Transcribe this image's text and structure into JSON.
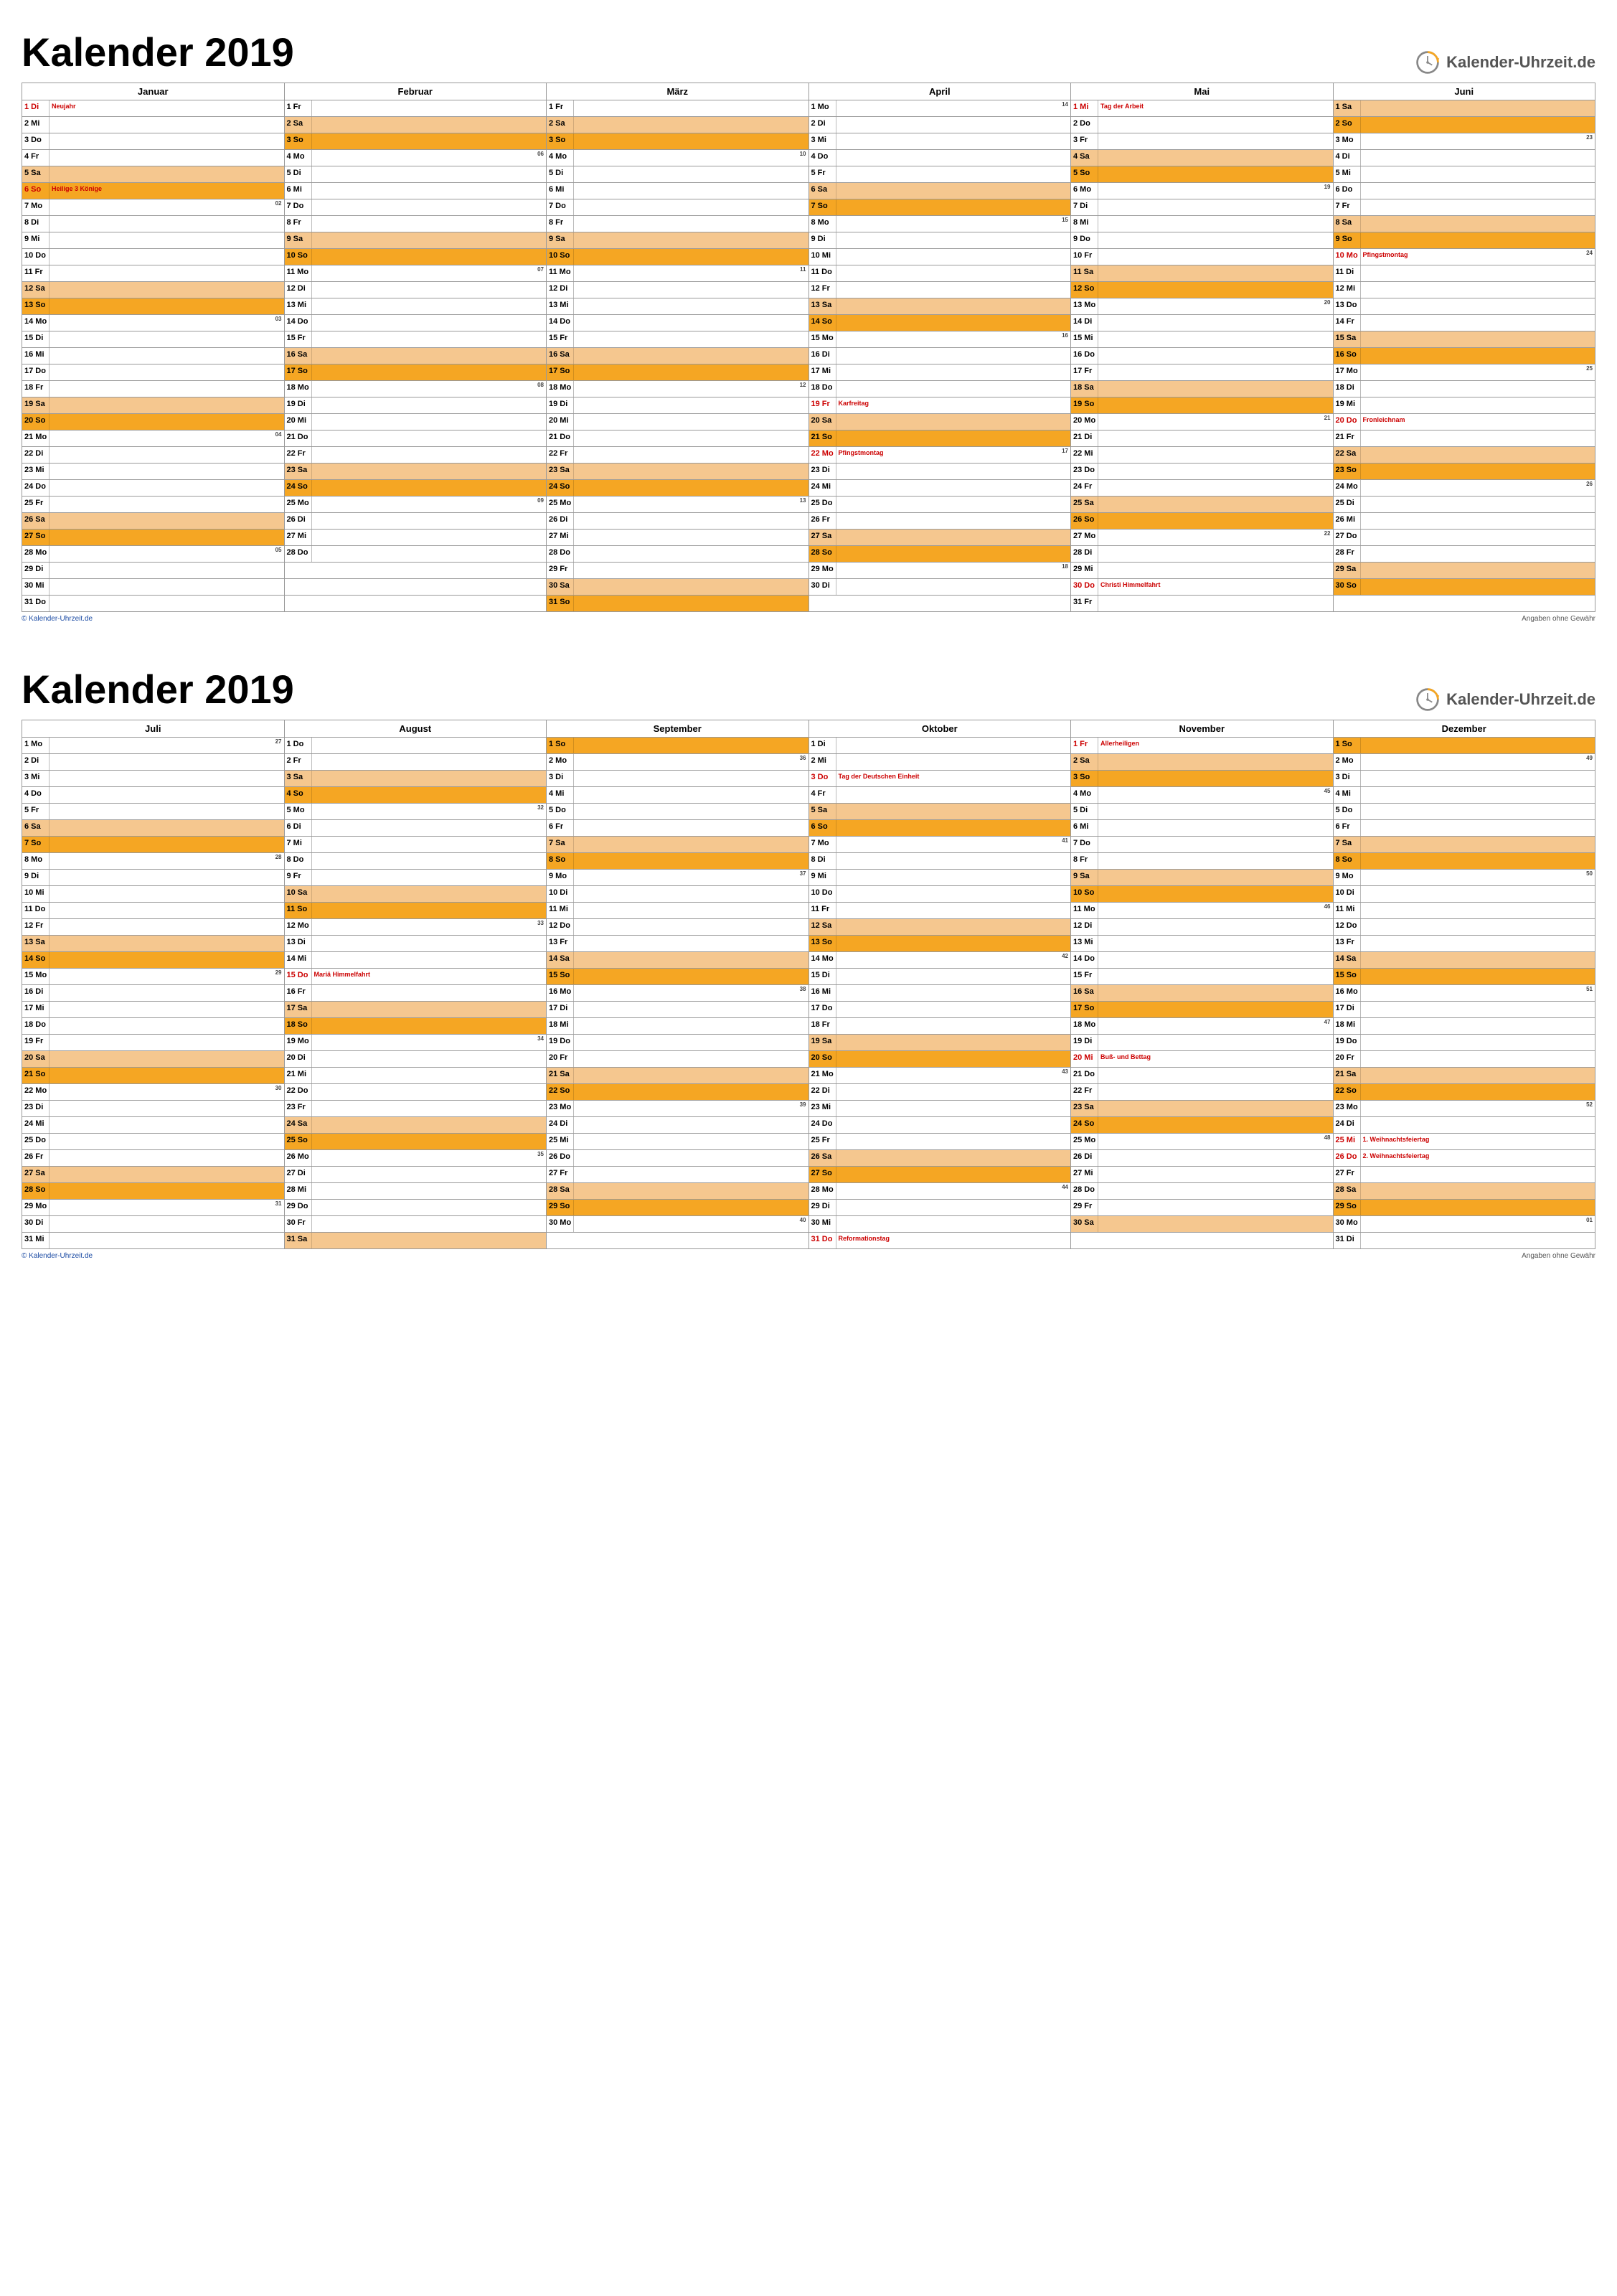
{
  "title": "Kalender 2019",
  "brand": "Kalender-Uhrzeit.de",
  "footer_left": "© Kalender-Uhrzeit.de",
  "footer_right": "Angaben ohne Gewähr",
  "weekday_short": [
    "Mo",
    "Di",
    "Mi",
    "Do",
    "Fr",
    "Sa",
    "So"
  ],
  "holidays": {
    "1-1": "Neujahr",
    "1-6": "Heilige 3 Könige",
    "4-19": "Karfreitag",
    "4-22": "Pfingstmontag",
    "5-1": "Tag der Arbeit",
    "5-30": "Christi Himmelfahrt",
    "6-10": "Pfingstmontag",
    "6-20": "Fronleichnam",
    "8-15": "Mariä Himmelfahrt",
    "10-3": "Tag der Deutschen Einheit",
    "10-31": "Reformationstag",
    "11-1": "Allerheiligen",
    "11-20": "Buß- und Bettag",
    "12-25": "1. Weihnachtsfeiertag",
    "12-26": "2. Weihnachtsfeiertag"
  },
  "half1": {
    "months": [
      "Januar",
      "Februar",
      "März",
      "April",
      "Mai",
      "Juni"
    ],
    "month_nums": [
      1,
      2,
      3,
      4,
      5,
      6
    ],
    "days_in_month": [
      31,
      28,
      31,
      30,
      31,
      30
    ],
    "first_weekday": [
      1,
      4,
      4,
      0,
      2,
      5
    ]
  },
  "half2": {
    "months": [
      "Juli",
      "August",
      "September",
      "Oktober",
      "November",
      "Dezember"
    ],
    "month_nums": [
      7,
      8,
      9,
      10,
      11,
      12
    ],
    "days_in_month": [
      31,
      31,
      30,
      31,
      30,
      31
    ],
    "first_weekday": [
      0,
      3,
      6,
      1,
      4,
      6
    ]
  }
}
